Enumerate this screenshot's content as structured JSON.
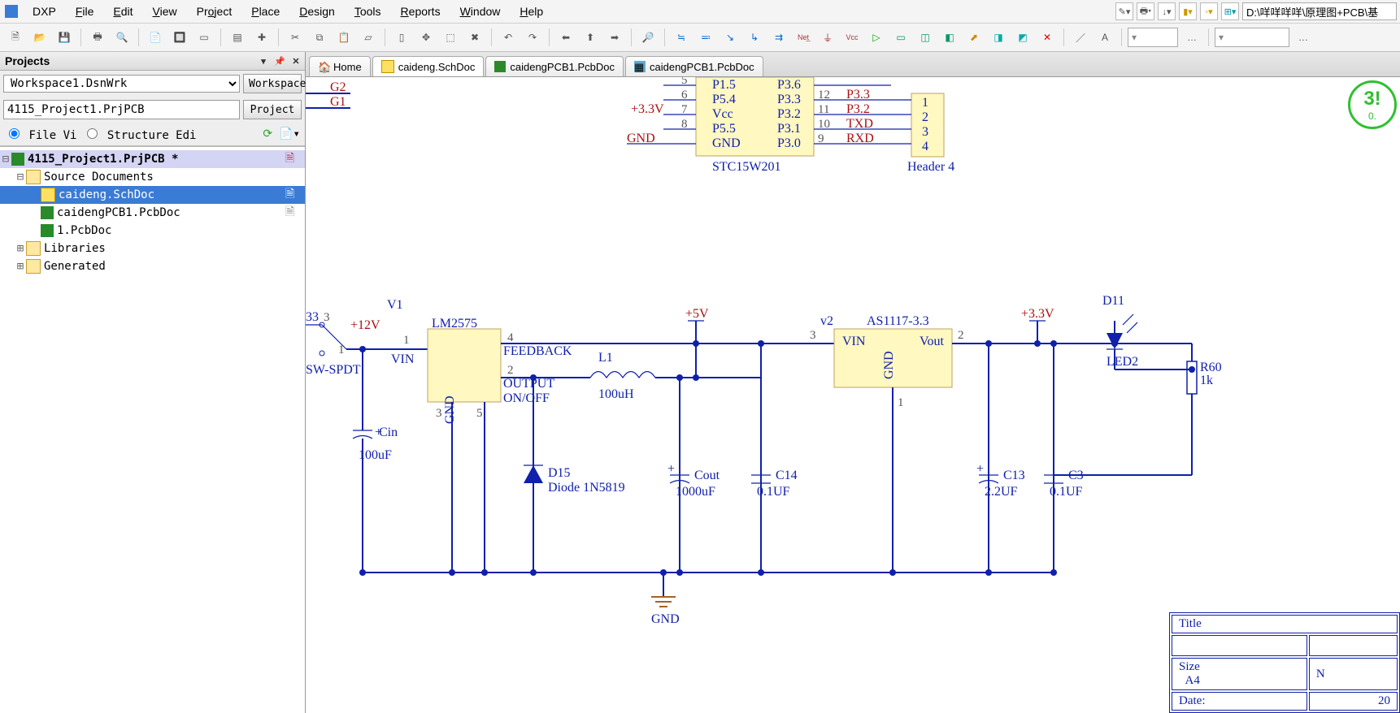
{
  "app": {
    "name": "DXP",
    "path_display": "D:\\咩咩咩咩\\原理图+PCB\\基"
  },
  "menu": {
    "file": "File",
    "edit": "Edit",
    "view": "View",
    "project": "Project",
    "place": "Place",
    "design": "Design",
    "tools": "Tools",
    "reports": "Reports",
    "window": "Window",
    "help": "Help"
  },
  "projects_panel": {
    "title": "Projects",
    "workspace_value": "Workspace1.DsnWrk",
    "workspace_btn": "Workspace",
    "project_value": "4115_Project1.PrjPCB",
    "project_btn": "Project",
    "radio_file": "File Vi",
    "radio_struct": "Structure Edi",
    "tree": {
      "proj": "4115_Project1.PrjPCB *",
      "source_docs": "Source Documents",
      "doc_sch": "caideng.SchDoc",
      "doc_pcb1": "caidengPCB1.PcbDoc",
      "doc_pcb2": "1.PcbDoc",
      "libraries": "Libraries",
      "generated": "Generated"
    }
  },
  "doctabs": {
    "home": "Home",
    "t1": "caideng.SchDoc",
    "t2": "caidengPCB1.PcbDoc",
    "t3": "caidengPCB1.PcbDoc"
  },
  "badge": {
    "big": "3!",
    "small": "0."
  },
  "schematic": {
    "ic1": {
      "name": "STC15W201",
      "pins_left": [
        {
          "num": "5",
          "lbl": "P1.5",
          "net": ""
        },
        {
          "num": "6",
          "lbl": "P5.4",
          "net": "+3.3V"
        },
        {
          "num": "7",
          "lbl": "Vcc",
          "net": ""
        },
        {
          "num": "8",
          "lbl": "P5.5",
          "net": "GND"
        },
        {
          "num": "",
          "lbl": "GND",
          "net": ""
        }
      ],
      "pins_right": [
        {
          "num": "",
          "lbl": "P3.6",
          "net": ""
        },
        {
          "num": "12",
          "lbl": "P3.3",
          "net": "P3.3"
        },
        {
          "num": "11",
          "lbl": "P3.2",
          "net": "P3.2"
        },
        {
          "num": "10",
          "lbl": "P3.1",
          "net": "TXD"
        },
        {
          "num": "9",
          "lbl": "P3.0",
          "net": "RXD"
        }
      ]
    },
    "header": {
      "name": "Header 4",
      "pins": [
        "1",
        "2",
        "3",
        "4"
      ]
    },
    "left_nets": [
      "G2",
      "G1"
    ],
    "v1": "V1",
    "sw": "SW-SPDT",
    "sw_pins": {
      "a": "3",
      "b": "1"
    },
    "p12v": "+12V",
    "vin": "VIN",
    "b3": "33",
    "lm2575": {
      "name": "LM2575",
      "pin1": "1",
      "pin4": "4",
      "pin2": "2",
      "pin3": "3",
      "pin5": "5",
      "fb": "FEEDBACK",
      "out": "OUTPUT",
      "onoff": "ON/OFF",
      "gnd": "GND"
    },
    "cin": {
      "name": "Cin",
      "val": "100uF"
    },
    "l1": {
      "name": "L1",
      "val": "100uH"
    },
    "d15": {
      "name": "D15",
      "val": "Diode 1N5819"
    },
    "cout": {
      "name": "Cout",
      "val": "1000uF"
    },
    "c14": {
      "name": "C14",
      "val": "0.1UF"
    },
    "p5v": "+5V",
    "v2": "v2",
    "as1117": {
      "name": "AS1117-3.3",
      "vin": "VIN",
      "vout": "Vout",
      "gnd": "GND",
      "pin3": "3",
      "pin2": "2",
      "pin1": "1"
    },
    "c13": {
      "name": "C13",
      "val": "2.2UF"
    },
    "c3": {
      "name": "C3",
      "val": "0.1UF"
    },
    "p33v": "+3.3V",
    "d11": "D11",
    "led2": "LED2",
    "r60": {
      "name": "R60",
      "val": "1k"
    },
    "gnd": "GND"
  },
  "titleblock": {
    "title_lbl": "Title",
    "size_lbl": "Size",
    "size_val": "A4",
    "n_lbl": "N",
    "date_lbl": "Date:",
    "date_val": "20"
  }
}
